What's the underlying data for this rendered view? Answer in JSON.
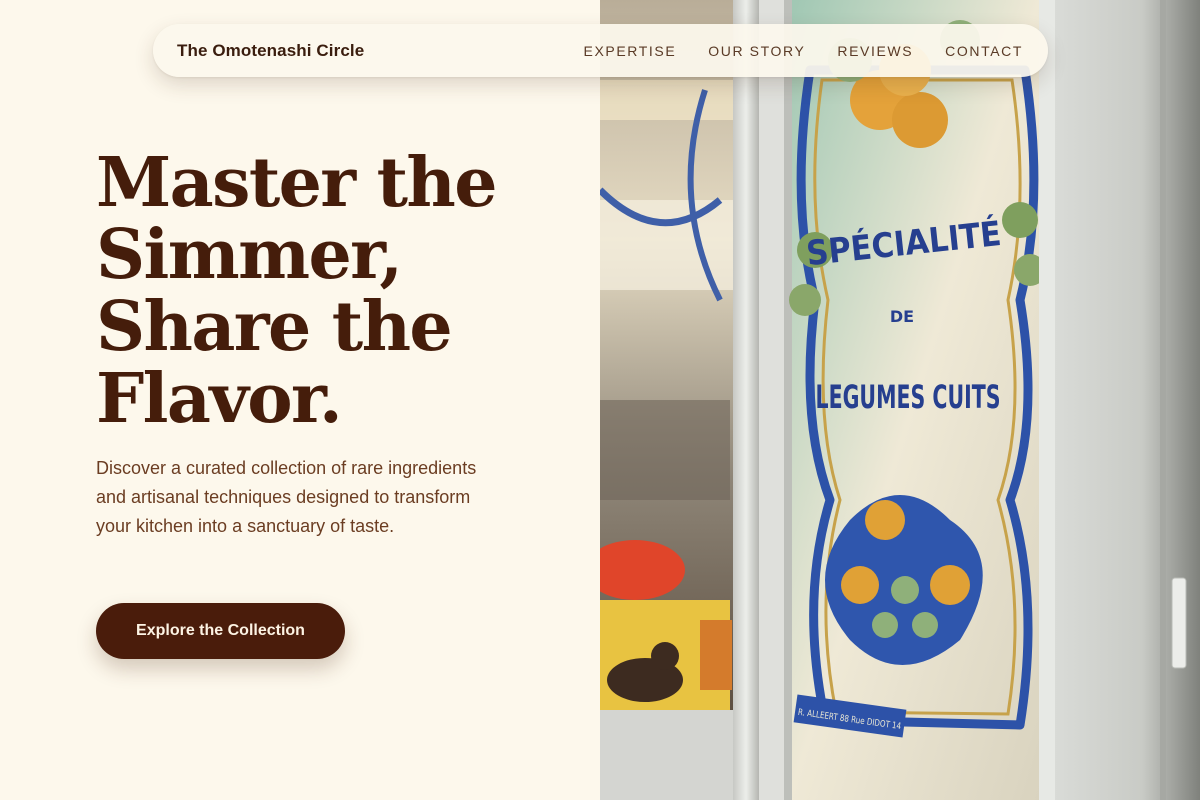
{
  "nav": {
    "brand": "The Omotenashi Circle",
    "links": [
      "EXPERTISE",
      "OUR STORY",
      "REVIEWS",
      "CONTACT"
    ]
  },
  "hero": {
    "headline_lines": [
      "Master the",
      "Simmer,",
      "Share the",
      "Flavor."
    ],
    "lede": "Discover a curated collection of rare ingredients and artisanal techniques designed to transform your kitchen into a sanctuary of taste.",
    "cta_label": "Explore the Collection"
  },
  "photo": {
    "sign_lines": [
      "SPÉCIALITÉ",
      "DE",
      "LEGUMES CUITS"
    ],
    "signature": "R. ALLEERT 88 Rue DIDOT 14"
  },
  "colors": {
    "background": "#fdf8ec",
    "heading": "#451d0b",
    "body_text": "#6b3d22",
    "button": "#4a1c0b"
  }
}
